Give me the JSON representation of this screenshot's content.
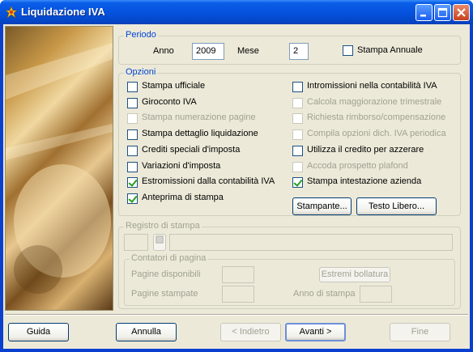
{
  "window": {
    "title": "Liquidazione IVA"
  },
  "periodo": {
    "title": "Periodo",
    "anno_label": "Anno",
    "anno_value": "2009",
    "mese_label": "Mese",
    "mese_value": "2",
    "stampa_annuale_label": "Stampa Annuale",
    "stampa_annuale_checked": false
  },
  "opzioni": {
    "title": "Opzioni",
    "left": [
      {
        "label": "Stampa ufficiale",
        "checked": false,
        "enabled": true
      },
      {
        "label": "Giroconto IVA",
        "checked": false,
        "enabled": true
      },
      {
        "label": "Stampa numerazione pagine",
        "checked": false,
        "enabled": false
      },
      {
        "label": "Stampa dettaglio liquidazione",
        "checked": false,
        "enabled": true
      },
      {
        "label": "Crediti speciali d'imposta",
        "checked": false,
        "enabled": true
      },
      {
        "label": "Variazioni d'imposta",
        "checked": false,
        "enabled": true
      },
      {
        "label": "Estromissioni dalla contabilità IVA",
        "checked": true,
        "enabled": true
      },
      {
        "label": "Anteprima di stampa",
        "checked": true,
        "enabled": true
      }
    ],
    "right": [
      {
        "label": "Intromissioni nella contabilità IVA",
        "checked": false,
        "enabled": true
      },
      {
        "label": "Calcola maggiorazione trimestrale",
        "checked": false,
        "enabled": false
      },
      {
        "label": "Richiesta rimborso/compensazione",
        "checked": false,
        "enabled": false
      },
      {
        "label": "Compila opzioni dich. IVA periodica",
        "checked": false,
        "enabled": false
      },
      {
        "label": "Utilizza il credito per azzerare",
        "checked": false,
        "enabled": true
      },
      {
        "label": "Accoda prospetto plafond",
        "checked": false,
        "enabled": false
      },
      {
        "label": "Stampa intestazione azienda",
        "checked": true,
        "enabled": true
      }
    ],
    "stampante_button": "Stampante...",
    "testo_libero_button": "Testo Libero..."
  },
  "registro": {
    "title": "Registro di stampa",
    "contatori_title": "Contatori di pagina",
    "pagine_disponibili_label": "Pagine disponibili",
    "pagine_stampate_label": "Pagine stampate",
    "estremi_bollatura_button": "Estremi bollatura",
    "anno_di_stampa_label": "Anno di stampa"
  },
  "footer": {
    "guida": "Guida",
    "annulla": "Annulla",
    "indietro": "< Indietro",
    "avanti": "Avanti >",
    "fine": "Fine"
  }
}
